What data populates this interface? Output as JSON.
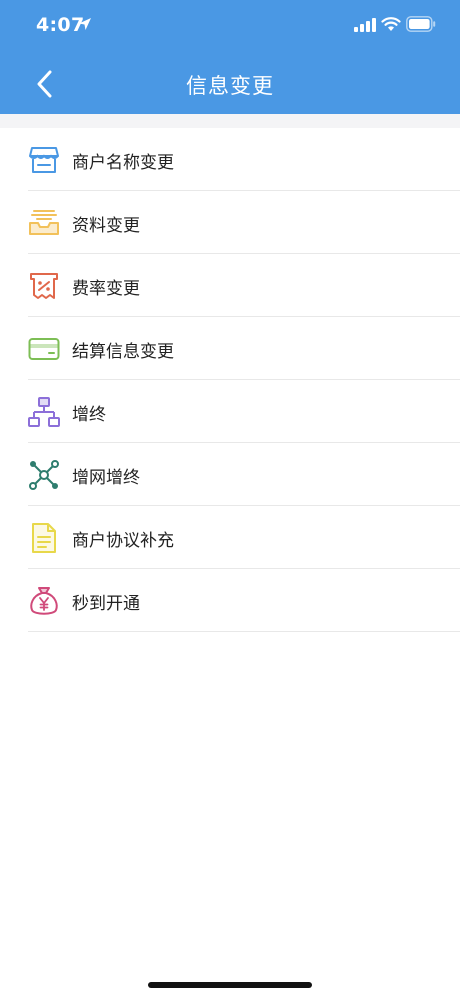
{
  "status_bar": {
    "time": "4:07"
  },
  "header": {
    "title": "信息变更",
    "bg_color": "#4A98E4"
  },
  "menu": {
    "items": [
      {
        "label": "商户名称变更",
        "icon": "storefront-icon",
        "color": "#4A98E4"
      },
      {
        "label": "资料变更",
        "icon": "inbox-tray-icon",
        "color": "#F2C15A"
      },
      {
        "label": "费率变更",
        "icon": "percent-receipt-icon",
        "color": "#E0684B"
      },
      {
        "label": "结算信息变更",
        "icon": "card-icon",
        "color": "#7DBE55"
      },
      {
        "label": "增终",
        "icon": "hierarchy-icon",
        "color": "#8C6FD9"
      },
      {
        "label": "增网增终",
        "icon": "network-nodes-icon",
        "color": "#2E7D6E"
      },
      {
        "label": "商户协议补充",
        "icon": "document-icon",
        "color": "#E8D84A"
      },
      {
        "label": "秒到开通",
        "icon": "money-bag-icon",
        "color": "#D04A7A"
      }
    ]
  }
}
